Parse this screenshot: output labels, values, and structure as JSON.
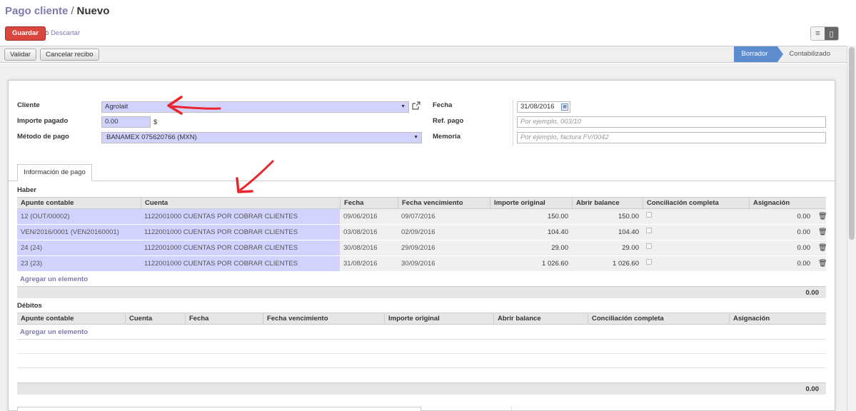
{
  "breadcrumb": {
    "parent": "Pago cliente",
    "separator": "/",
    "current": "Nuevo"
  },
  "toolbar": {
    "save_label": "Guardar",
    "or_label": "ó",
    "discard_label": "Descartar"
  },
  "actions": {
    "validate_label": "Validar",
    "cancel_receipt_label": "Cancelar recibo"
  },
  "status": {
    "draft": "Borrador",
    "posted": "Contabilizado"
  },
  "form": {
    "customer_label": "Cliente",
    "customer_value": "Agrolait",
    "amount_label": "Importe pagado",
    "amount_value": "0.00",
    "currency_symbol": "$",
    "method_label": "Método de pago",
    "method_value": "BANAMEX 075620766 (MXN)",
    "date_label": "Fecha",
    "date_value": "31/08/2016",
    "ref_label": "Ref. pago",
    "ref_placeholder": "Por ejemplo, 003/10",
    "memo_label": "Memoria",
    "memo_placeholder": "Por ejemplo, factura FV/0042"
  },
  "tab_label": "Información de pago",
  "credits": {
    "title": "Haber",
    "columns": [
      "Apunte contable",
      "Cuenta",
      "Fecha",
      "Fecha vencimiento",
      "Importe original",
      "Abrir balance",
      "Conciliación completa",
      "Asignación"
    ],
    "rows": [
      {
        "move": "12 (OUT/00002)",
        "account": "1122001000 CUENTAS POR COBRAR CLIENTES",
        "date": "09/06/2016",
        "due": "09/07/2016",
        "original": "150.00",
        "open": "150.00",
        "allocation": "0.00"
      },
      {
        "move": "VEN/2016/0001 (VEN20160001)",
        "account": "1122001000 CUENTAS POR COBRAR CLIENTES",
        "date": "03/08/2016",
        "due": "02/09/2016",
        "original": "104.40",
        "open": "104.40",
        "allocation": "0.00"
      },
      {
        "move": "24 (24)",
        "account": "1122001000 CUENTAS POR COBRAR CLIENTES",
        "date": "30/08/2016",
        "due": "29/09/2016",
        "original": "29.00",
        "open": "29.00",
        "allocation": "0.00"
      },
      {
        "move": "23 (23)",
        "account": "1122001000 CUENTAS POR COBRAR CLIENTES",
        "date": "31/08/2016",
        "due": "30/09/2016",
        "original": "1 026.60",
        "open": "1 026.60",
        "allocation": "0.00"
      }
    ],
    "add_label": "Agregar un elemento",
    "total": "0.00"
  },
  "debits": {
    "title": "Débitos",
    "columns": [
      "Apunte contable",
      "Cuenta",
      "Fecha",
      "Fecha vencimiento",
      "Importe original",
      "Abrir balance",
      "Conciliación completa",
      "Asignación"
    ],
    "add_label": "Agregar un elemento",
    "total": "0.00"
  },
  "icons": {
    "dropdown": "caret-down-icon",
    "external": "external-link-icon",
    "calendar": "calendar-icon",
    "trash": "trash-icon",
    "list_view": "list-view-icon",
    "form_view": "form-view-icon"
  },
  "colors": {
    "selected_field": "#D2D2FF",
    "save_button": "#D9473F",
    "status_active": "#5D8DCF",
    "link": "#7C7BAD",
    "annotation": "#E8262C"
  }
}
